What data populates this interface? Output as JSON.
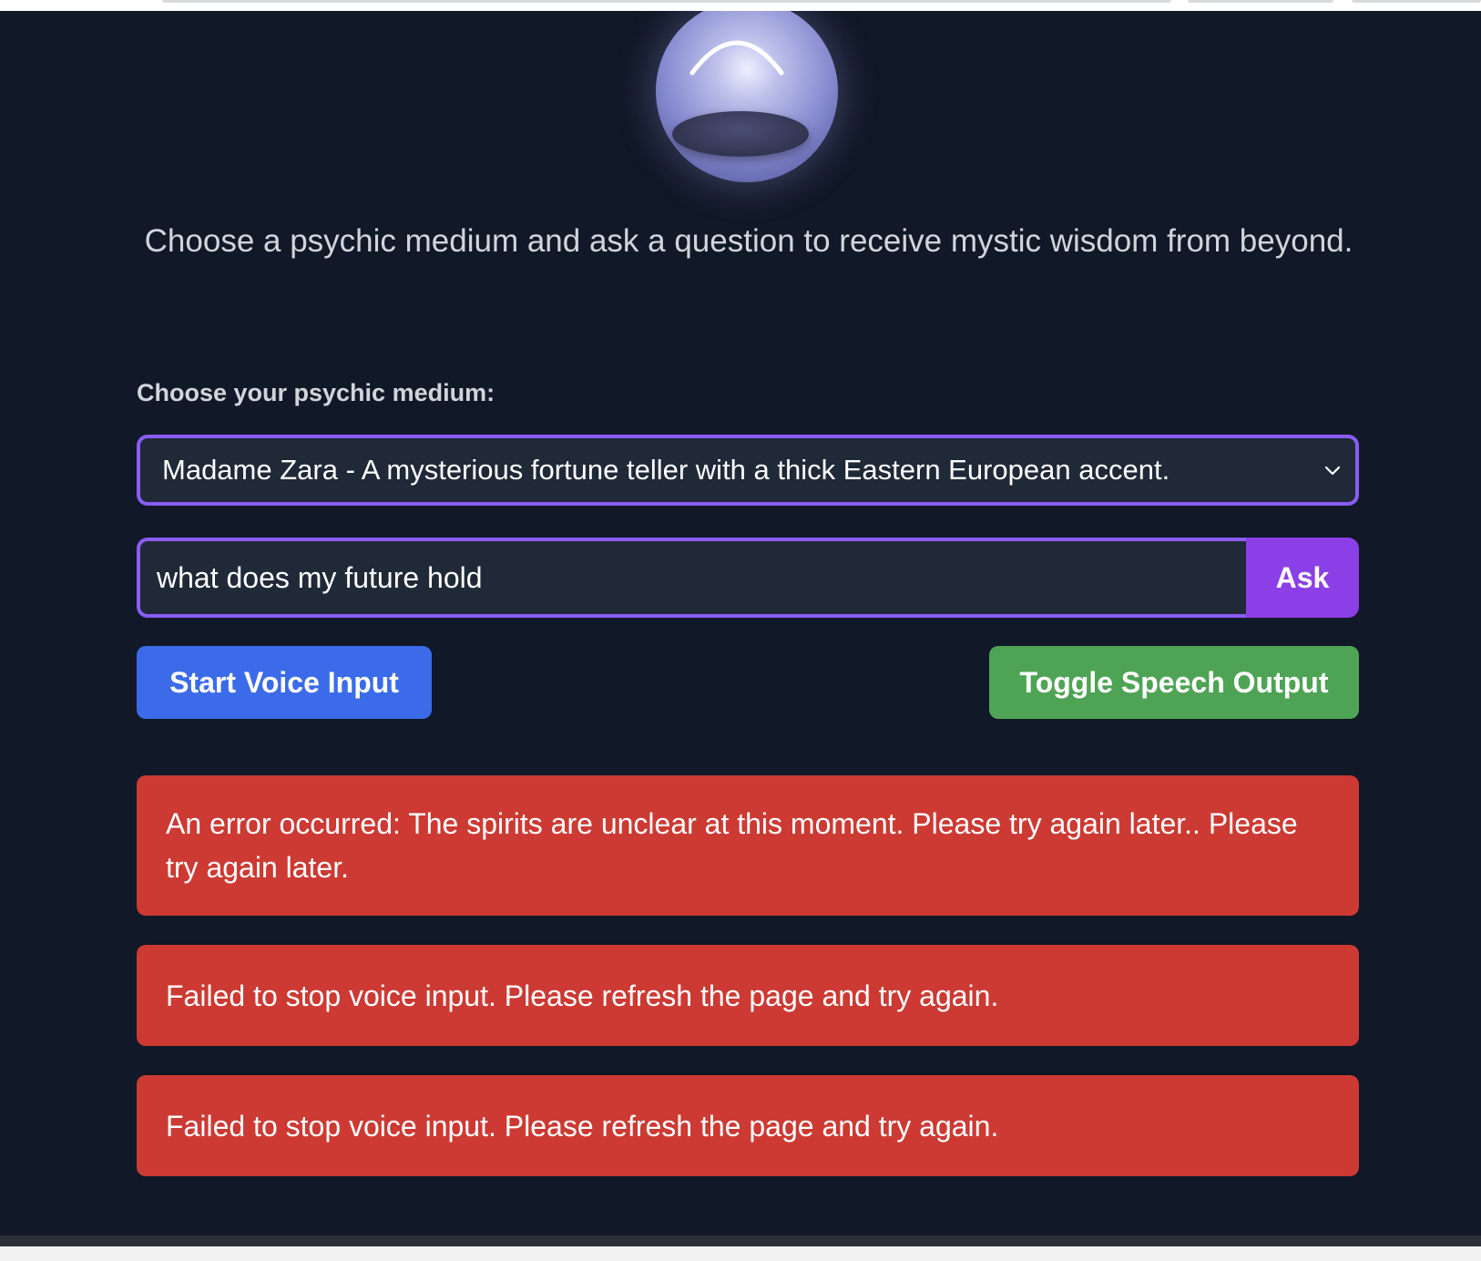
{
  "intro": {
    "text": "Choose a psychic medium and ask a question to receive mystic wisdom from beyond."
  },
  "medium": {
    "label": "Choose your psychic medium:",
    "selected": "Madame Zara - A mysterious fortune teller with a thick Eastern European accent."
  },
  "question": {
    "value": "what does my future hold",
    "ask_label": "Ask"
  },
  "controls": {
    "voice_label": "Start Voice Input",
    "speech_label": "Toggle Speech Output"
  },
  "errors": [
    "An error occurred: The spirits are unclear at this moment. Please try again later.. Please try again later.",
    "Failed to stop voice input. Please refresh the page and try again.",
    "Failed to stop voice input. Please refresh the page and try again."
  ],
  "colors": {
    "background": "#111827",
    "accent_purple": "#8b5cf6",
    "ask_button": "#8b3fe6",
    "voice_button": "#3b6be8",
    "speech_button": "#4fa355",
    "error": "#cc3a33"
  },
  "icons": {
    "orb": "crystal-ball-icon",
    "select_arrow": "chevron-down-icon"
  }
}
